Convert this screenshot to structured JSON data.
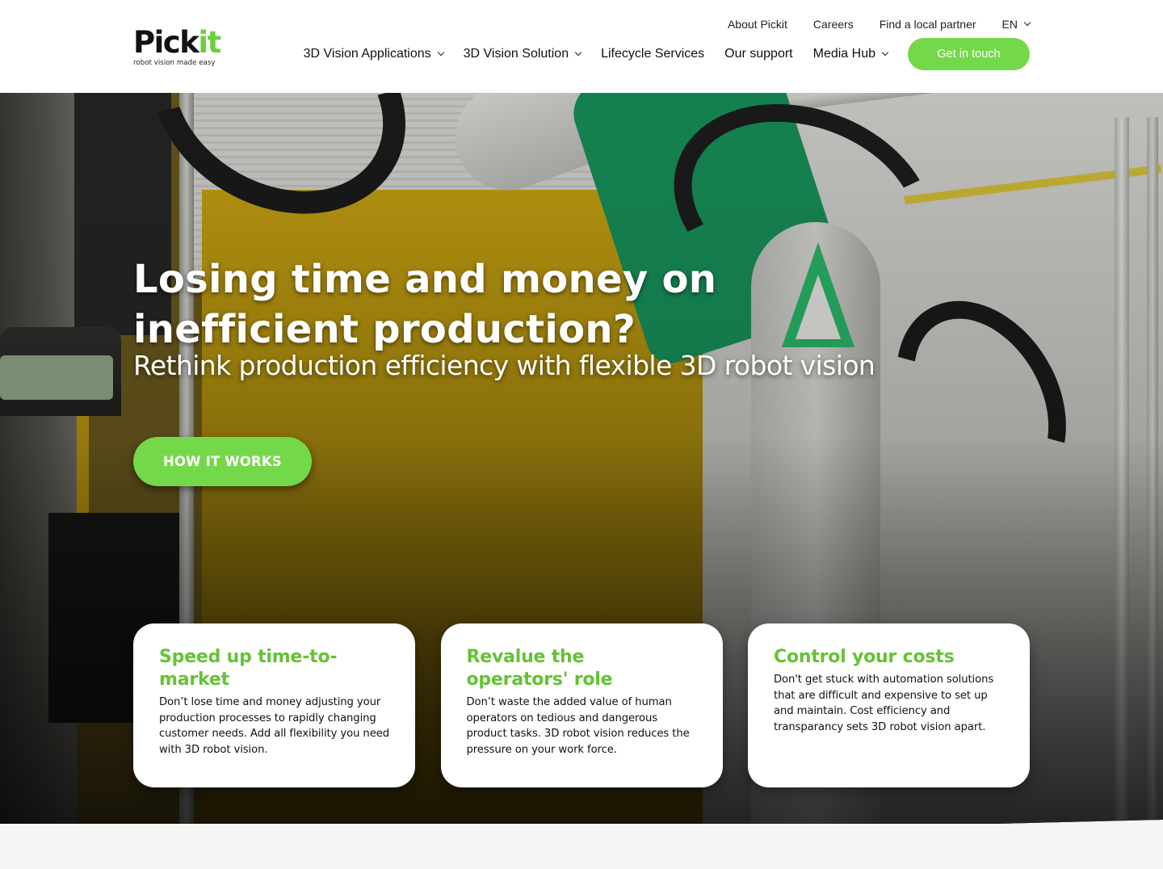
{
  "brand": {
    "name_main": "Pick",
    "name_accent": "it",
    "tagline": "robot vision made easy",
    "accent_color": "#74d94a",
    "title_green": "#65c234"
  },
  "top_nav": {
    "items": [
      {
        "label": "About Pickit"
      },
      {
        "label": "Careers"
      },
      {
        "label": "Find a local partner"
      }
    ],
    "language": {
      "label": "EN",
      "icon": "chevron-down-icon"
    }
  },
  "main_nav": {
    "items": [
      {
        "label": "3D Vision Applications",
        "has_dropdown": true
      },
      {
        "label": "3D Vision Solution",
        "has_dropdown": true
      },
      {
        "label": "Lifecycle Services",
        "has_dropdown": false
      },
      {
        "label": "Our support",
        "has_dropdown": false
      },
      {
        "label": "Media Hub",
        "has_dropdown": true
      }
    ],
    "cta_label": "Get in touch"
  },
  "hero": {
    "title": "Losing time and money on inefficient production?",
    "subtitle": "Rethink production efficiency with flexible 3D robot vision",
    "button_label": "HOW IT WORKS"
  },
  "cards": [
    {
      "title": "Speed up time-to-market",
      "text": "Don’t lose time and money adjusting your production processes to rapidly changing customer needs. Add all flexibility you need with 3D robot vision."
    },
    {
      "title": "Revalue the operators' role",
      "text": "Don’t waste the added value of human operators on tedious and dangerous product tasks. 3D robot vision reduces the pressure on your work force."
    },
    {
      "title": "Control your costs",
      "text": "Don't get stuck with automation solutions that are difficult and expensive to set up and maintain. Cost efficiency and transparancy sets 3D robot vision apart."
    }
  ]
}
